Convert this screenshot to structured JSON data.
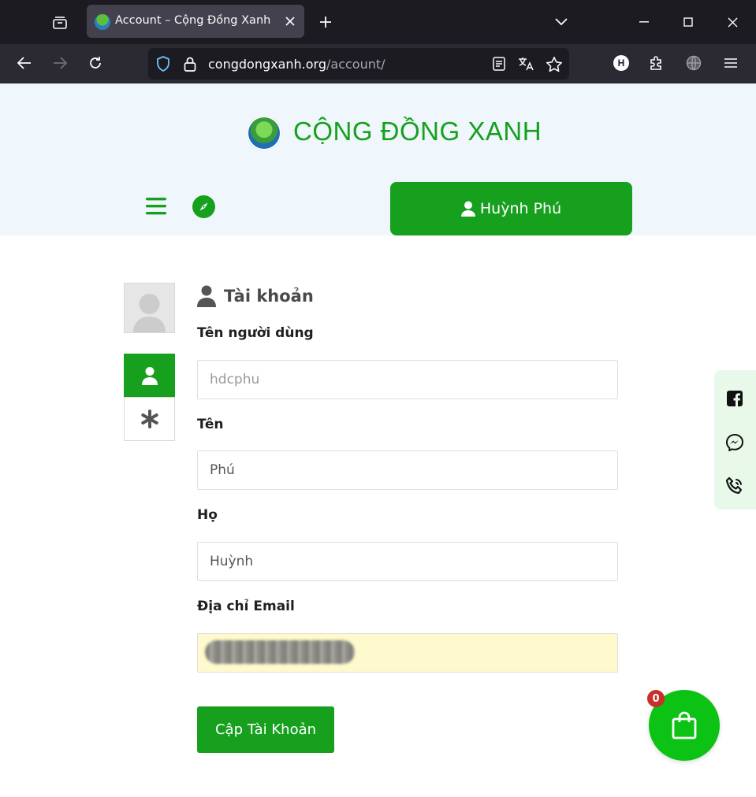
{
  "browser": {
    "tab_title": "Account – Cộng Đồng Xanh",
    "url_domain": "congdongxanh.org",
    "url_path": "/account/",
    "extension_badge": "H"
  },
  "header": {
    "logo_text": "CỘNG ĐỒNG XANH",
    "user_name": "Huỳnh Phú"
  },
  "account": {
    "section_title": "Tài khoản",
    "username_label": "Tên người dùng",
    "username_value": "hdcphu",
    "first_name_label": "Tên",
    "first_name_value": "Phú",
    "last_name_label": "Họ",
    "last_name_value": "Huỳnh",
    "email_label": "Địa chỉ Email",
    "submit_label": "Cập Tài Khoản"
  },
  "cart": {
    "count": "0"
  },
  "colors": {
    "brand_green": "#16a01e",
    "cart_green": "#0cc214",
    "badge_red": "#c9302c",
    "autofill": "#fffacd"
  },
  "icons": {
    "tab_list": "tab-list-icon",
    "new_tab": "plus-icon",
    "back": "back-arrow-icon",
    "forward": "forward-arrow-icon",
    "reload": "reload-icon",
    "shield": "shield-icon",
    "lock": "lock-icon",
    "reader": "reader-view-icon",
    "translate": "translate-icon",
    "bookmark": "star-icon",
    "extensions": "puzzle-icon",
    "menu": "hamburger-icon",
    "compass": "compass-icon",
    "user": "user-icon",
    "facebook": "facebook-icon",
    "messenger": "messenger-icon",
    "phone": "phone-icon",
    "cart": "shopping-bag-icon"
  }
}
